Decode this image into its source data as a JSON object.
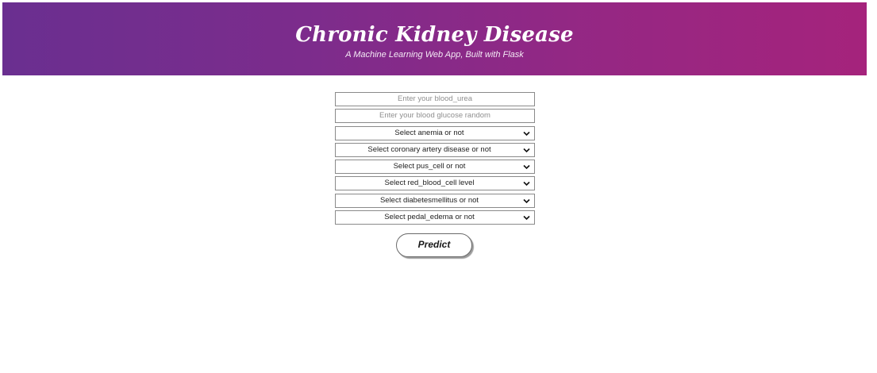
{
  "header": {
    "title": "Chronic Kidney Disease",
    "subtitle": "A Machine Learning Web App, Built with Flask"
  },
  "form": {
    "fields": [
      {
        "type": "text",
        "placeholder": "Enter your blood_urea"
      },
      {
        "type": "text",
        "placeholder": "Enter your blood glucose random"
      },
      {
        "type": "select",
        "selected": "Select anemia or not"
      },
      {
        "type": "select",
        "selected": "Select coronary artery disease or not"
      },
      {
        "type": "select",
        "selected": "Select pus_cell or not"
      },
      {
        "type": "select",
        "selected": "Select red_blood_cell level"
      },
      {
        "type": "select",
        "selected": "Select diabetesmellitus or not"
      },
      {
        "type": "select",
        "selected": "Select pedal_edema or not"
      }
    ],
    "submit_label": "Predict"
  },
  "colors": {
    "banner_gradient_start": "#6a2f90",
    "banner_gradient_end": "#a5237c",
    "banner_text": "#ffffff"
  },
  "icons": {
    "select_arrow": "chevron-down-icon"
  }
}
